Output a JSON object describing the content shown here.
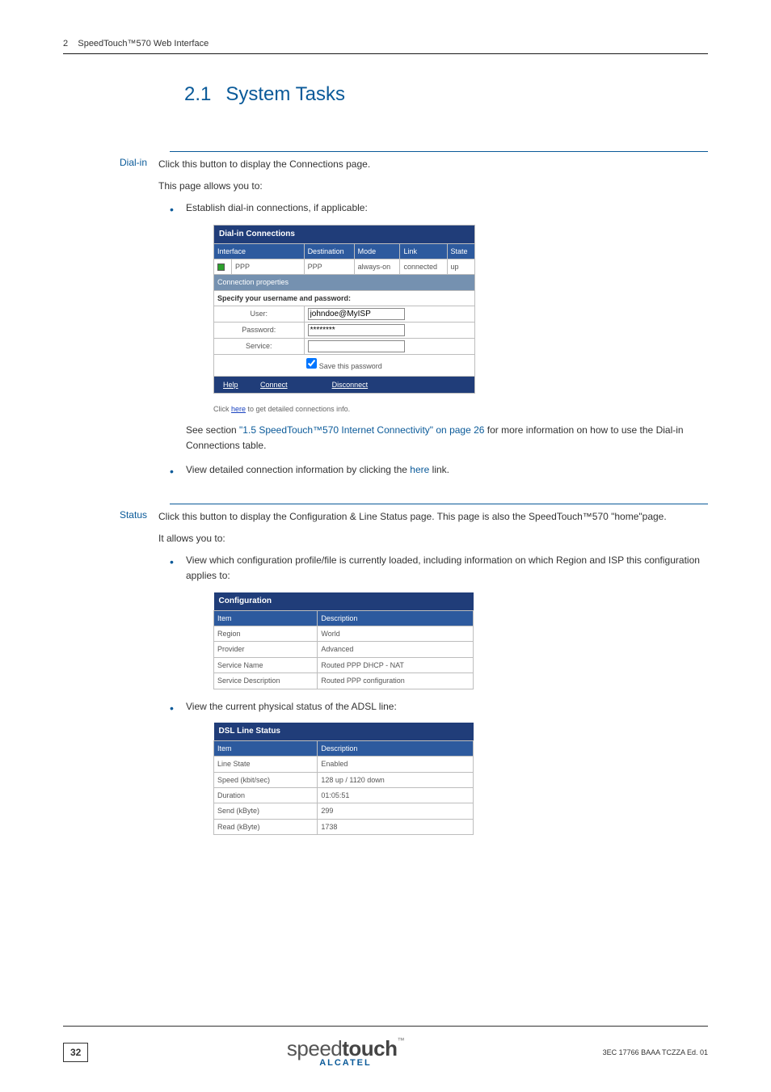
{
  "header": {
    "chapter_num": "2",
    "chapter_title": "SpeedTouch™570 Web Interface"
  },
  "title": {
    "number": "2.1",
    "text": "System Tasks"
  },
  "dialin": {
    "label": "Dial-in",
    "intro": "Click this button to display the Connections page.",
    "allows": "This page allows you to:",
    "bullet1": "Establish dial-in connections, if applicable:",
    "table": {
      "title": "Dial-in Connections",
      "headers": [
        "Interface",
        "Destination",
        "Mode",
        "Link",
        "State"
      ],
      "row": {
        "iface": "PPP",
        "dest": "PPP",
        "mode": "always-on",
        "link": "connected",
        "state": "up"
      },
      "propbar": "Connection properties",
      "specify": "Specify your username and password:",
      "user_label": "User:",
      "user_value": "johndoe@MyISP",
      "pass_label": "Password:",
      "pass_value": "********",
      "service_label": "Service:",
      "service_value": "",
      "save_label": "Save this password",
      "help": "Help",
      "connect": "Connect",
      "disconnect": "Disconnect"
    },
    "caption_prefix": "Click ",
    "caption_link": "here",
    "caption_suffix": " to get detailed connections info.",
    "see_prefix": "See section ",
    "see_link": "\"1.5 SpeedTouch™570 Internet Connectivity\" on page 26",
    "see_suffix": " for more information on how to use the Dial-in Connections table.",
    "bullet2_prefix": "View detailed connection information by clicking the ",
    "bullet2_link": "here",
    "bullet2_suffix": " link."
  },
  "status": {
    "label": "Status",
    "intro": "Click this button to display the Configuration & Line Status page. This page is also the SpeedTouch™570 \"home\"page.",
    "allows": "It allows you to:",
    "bullet1": "View which configuration profile/file is currently loaded, including information on which Region and ISP this configuration applies to:",
    "config_table": {
      "title": "Configuration",
      "headers": [
        "Item",
        "Description"
      ],
      "rows": [
        [
          "Region",
          "World"
        ],
        [
          "Provider",
          "Advanced"
        ],
        [
          "Service Name",
          "Routed PPP DHCP - NAT"
        ],
        [
          "Service Description",
          "Routed PPP configuration"
        ]
      ]
    },
    "bullet2": "View the current physical status of the ADSL line:",
    "dsl_table": {
      "title": "DSL Line Status",
      "headers": [
        "Item",
        "Description"
      ],
      "rows": [
        [
          "Line State",
          "Enabled"
        ],
        [
          "Speed (kbit/sec)",
          "128 up / 1120 down"
        ],
        [
          "Duration",
          "01:05:51"
        ],
        [
          "Send (kByte)",
          "299"
        ],
        [
          "Read (kByte)",
          "1738"
        ]
      ]
    }
  },
  "footer": {
    "page_num": "32",
    "doc_code": "3EC 17766 BAAA TCZZA Ed. 01",
    "logo_light": "speed",
    "logo_bold": "touch",
    "logo_sub": "ALCATEL"
  }
}
